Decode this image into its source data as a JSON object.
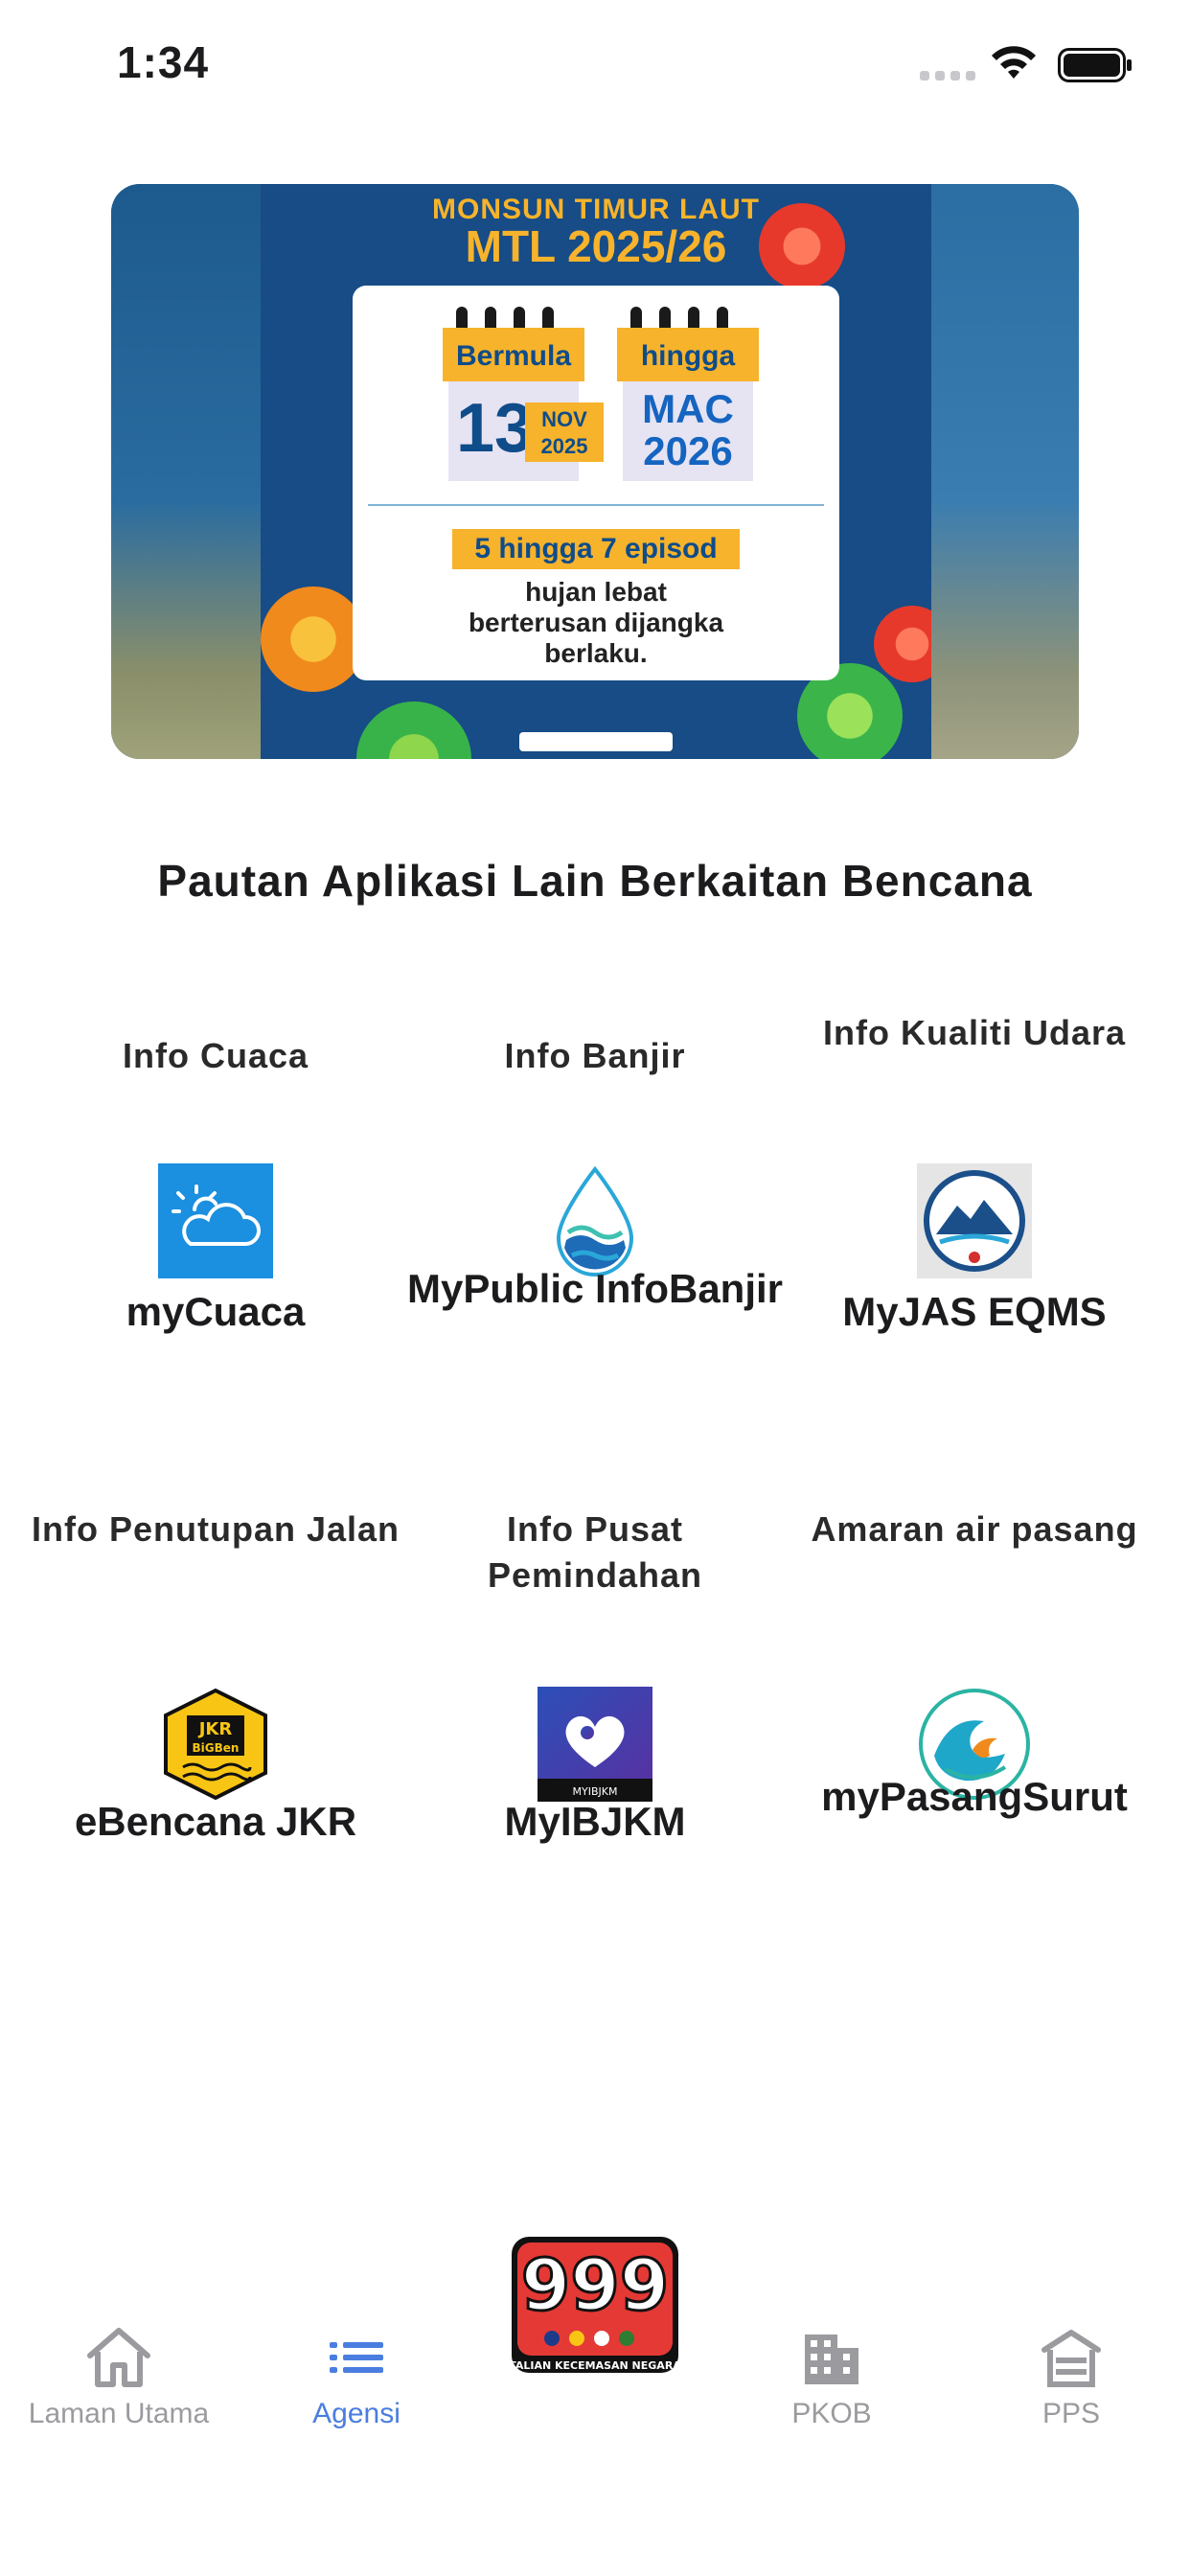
{
  "status_bar": {
    "time": "1:34"
  },
  "banner": {
    "title_line1": "MONSUN TIMUR LAUT",
    "title_line2": "MTL 2025/26",
    "start_label": "Bermula",
    "start_day": "13",
    "start_month": "NOV",
    "start_year": "2025",
    "end_label": "hingga",
    "end_month": "MAC",
    "end_year": "2026",
    "episodes": "5 hingga 7 episod",
    "desc_line1": "hujan lebat",
    "desc_line2": "berterusan dijangka",
    "desc_line3": "berlaku."
  },
  "section": {
    "title": "Pautan Aplikasi Lain Berkaitan Bencana"
  },
  "apps": [
    {
      "category": "Info Cuaca",
      "name": "myCuaca",
      "icon": "weather-cloud-sun-icon"
    },
    {
      "category": "Info Banjir",
      "name": "MyPublic InfoBanjir",
      "icon": "water-drop-icon"
    },
    {
      "category": "Info Kualiti Udara",
      "name": "MyJAS EQMS",
      "icon": "myjas-eqms-logo-icon"
    },
    {
      "category": "Info Penutupan Jalan",
      "name": "eBencana JKR",
      "icon": "jkr-bigben-logo-icon"
    },
    {
      "category": "Info Pusat Pemindahan",
      "name": "MyIBJKM",
      "icon": "myibjkm-heart-icon"
    },
    {
      "category": "Amaran air pasang",
      "name": "myPasangSurut",
      "icon": "wave-logo-icon"
    }
  ],
  "tabbar": {
    "items": [
      {
        "label": "Laman Utama",
        "icon": "home-icon",
        "active": false
      },
      {
        "label": "Agensi",
        "icon": "list-icon",
        "active": true
      },
      {
        "label": "PKOB",
        "icon": "building-icon",
        "active": false
      },
      {
        "label": "PPS",
        "icon": "shelter-icon",
        "active": false
      }
    ],
    "emergency": {
      "number": "999",
      "caption": "TALIAN KECEMASAN NEGARA"
    }
  },
  "colors": {
    "accent": "#4a7de0",
    "inactive": "#9b9b9f",
    "banner_yellow": "#f7b32b",
    "banner_blue": "#174c86"
  }
}
